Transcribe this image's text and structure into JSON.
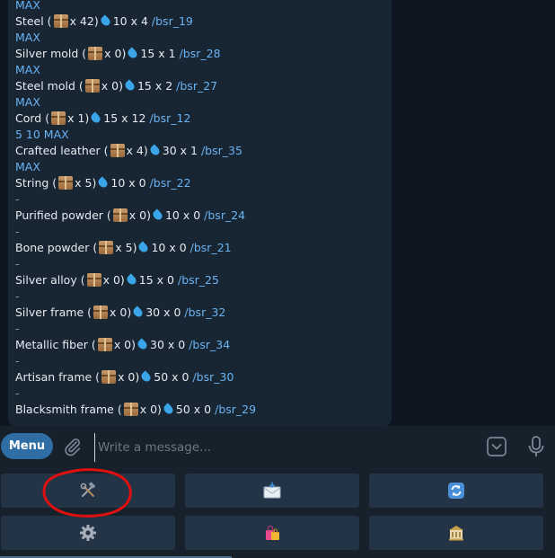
{
  "messages": {
    "top_action": "MAX",
    "items": [
      {
        "name": "Steel",
        "qty": "x 42)",
        "stat": "10 x 4",
        "cmd": "/bsr_19",
        "action": "MAX"
      },
      {
        "name": "Silver mold",
        "qty": "x 0)",
        "stat": "15 x 1",
        "cmd": "/bsr_28",
        "action": "MAX"
      },
      {
        "name": "Steel mold",
        "qty": "x 0)",
        "stat": "15 x 2",
        "cmd": "/bsr_27",
        "action": "MAX"
      },
      {
        "name": "Cord",
        "qty": "x 1)",
        "stat": "15 x 12",
        "cmd": "/bsr_12",
        "action": "5  10  MAX"
      },
      {
        "name": "Crafted leather",
        "qty": "x 4)",
        "stat": "30 x 1",
        "cmd": "/bsr_35",
        "action": "MAX"
      },
      {
        "name": "String",
        "qty": "x 5)",
        "stat": "10 x 0",
        "cmd": "/bsr_22",
        "action": "-"
      },
      {
        "name": "Purified powder",
        "qty": "x 0)",
        "stat": "10 x 0",
        "cmd": "/bsr_24",
        "action": "-"
      },
      {
        "name": "Bone powder",
        "qty": "x 5)",
        "stat": "10 x 0",
        "cmd": "/bsr_21",
        "action": "-"
      },
      {
        "name": "Silver alloy",
        "qty": "x 0)",
        "stat": "15 x 0",
        "cmd": "/bsr_25",
        "action": "-"
      },
      {
        "name": "Silver frame",
        "qty": "x 0)",
        "stat": "30 x 0",
        "cmd": "/bsr_32",
        "action": "-"
      },
      {
        "name": "Metallic fiber",
        "qty": "x 0)",
        "stat": "30 x 0",
        "cmd": "/bsr_34",
        "action": "-"
      },
      {
        "name": "Artisan frame",
        "qty": "x 0)",
        "stat": "50 x 0",
        "cmd": "/bsr_30",
        "action": "-"
      },
      {
        "name": "Blacksmith frame",
        "qty": "x 0)",
        "stat": "50 x 0",
        "cmd": "/bsr_29",
        "action": "-"
      }
    ]
  },
  "input_bar": {
    "menu_label": "Menu",
    "placeholder": "Write a message..."
  },
  "keyboard": {
    "buttons": [
      {
        "icon": "hammer-and-wrench-icon",
        "glyph": "⚒"
      },
      {
        "icon": "incoming-envelope-icon",
        "glyph": "📨"
      },
      {
        "icon": "refresh-icon",
        "glyph": "🔄"
      },
      {
        "icon": "gear-icon",
        "glyph": "⚙"
      },
      {
        "icon": "shopping-bags-icon",
        "glyph": "🛍"
      },
      {
        "icon": "bank-icon",
        "glyph": "🏦"
      }
    ]
  },
  "colors": {
    "chat_background": "#0e1621",
    "bubble": "#182533",
    "link": "#6ab3f3",
    "menu_button": "#2f6ea5",
    "keyboard_button": "#243447",
    "annotation_circle": "#e01010"
  }
}
